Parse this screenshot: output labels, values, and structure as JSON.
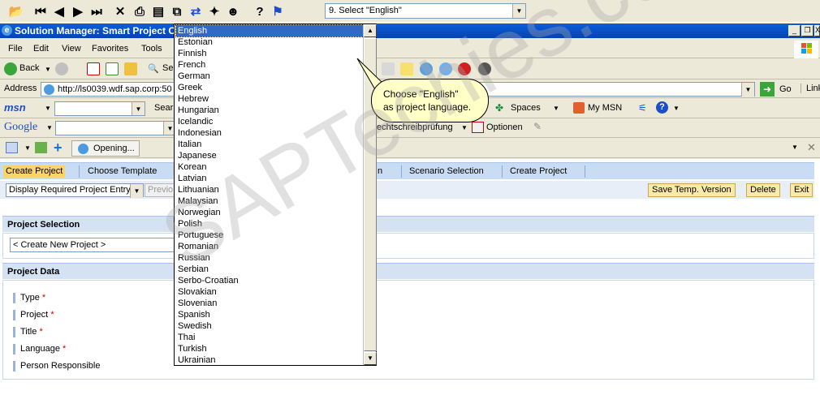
{
  "tutorial_toolbar": {
    "step_select_value": "9. Select \"English\""
  },
  "window": {
    "title": "Solution Manager: Smart Project C",
    "controls": [
      "_",
      "❐",
      "X"
    ]
  },
  "menubar": {
    "items": [
      "File",
      "Edit",
      "View",
      "Favorites",
      "Tools"
    ]
  },
  "navbar": {
    "back_label": "Back",
    "search_label": "Se"
  },
  "addressbar": {
    "label": "Address",
    "url": "http://ls0039.wdf.sap.corp:50",
    "go_label": "Go",
    "links_label": "Link"
  },
  "msnbar": {
    "logo": "msn",
    "search_label": "Sear",
    "spaces_label": "Spaces",
    "mymsn_label": "My MSN"
  },
  "googlebar": {
    "logo": "Google",
    "spellcheck_label": "echtschreibprüfung",
    "options_label": "Optionen"
  },
  "linkbar": {
    "opening_label": "Opening..."
  },
  "sap": {
    "roadmap": {
      "steps": [
        "Create Project",
        "Choose Template",
        "n",
        "Scenario Selection",
        "Create Project"
      ]
    },
    "actionbar": {
      "view_select": "Display Required Project Entry",
      "prev_label": "Previo",
      "save_label": "Save Temp. Version",
      "delete_label": "Delete",
      "exit_label": "Exit"
    },
    "project_selection": {
      "heading": "Project Selection",
      "input_value": "< Create New Project >"
    },
    "project_data": {
      "heading": "Project Data",
      "fields": [
        {
          "label": "Type",
          "required": "*"
        },
        {
          "label": "Project",
          "required": "*"
        },
        {
          "label": "Title",
          "required": "*"
        },
        {
          "label": "Language",
          "required": "*"
        },
        {
          "label": "Person Responsible",
          "required": ""
        }
      ]
    }
  },
  "language_list": {
    "selected": "English",
    "options": [
      "English",
      "Estonian",
      "Finnish",
      "French",
      "German",
      "Greek",
      "Hebrew",
      "Hungarian",
      "Icelandic",
      "Indonesian",
      "Italian",
      "Japanese",
      "Korean",
      "Latvian",
      "Lithuanian",
      "Malaysian",
      "Norwegian",
      "Polish",
      "Portuguese",
      "Romanian",
      "Russian",
      "Serbian",
      "Serbo-Croatian",
      "Slovakian",
      "Slovenian",
      "Spanish",
      "Swedish",
      "Thai",
      "Turkish",
      "Ukrainian"
    ]
  },
  "callout": {
    "line1": "Choose \"English\"",
    "line2": "as project language."
  },
  "watermark": "SAPTechies.com"
}
